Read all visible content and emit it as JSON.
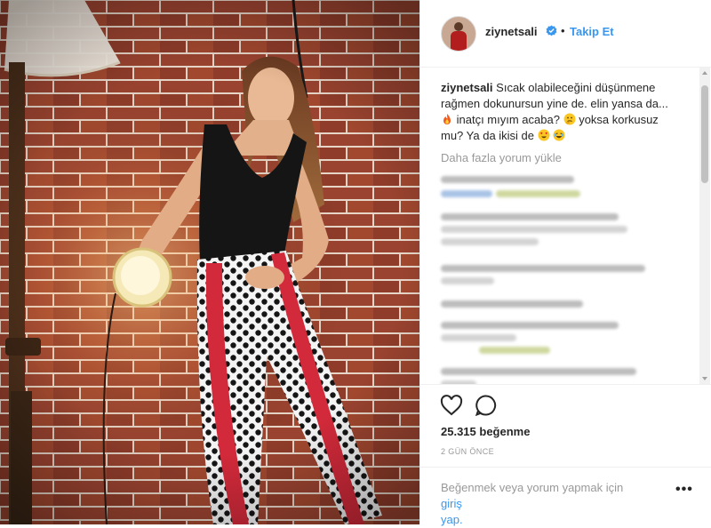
{
  "post": {
    "username": "ziynetsali",
    "verified_icon": "verified-badge-icon",
    "separator": "•",
    "follow_label": "Takip Et",
    "caption": {
      "username": "ziynetsali",
      "text_part1": "Sıcak olabileceğini düşünmene rağmen dokunursun yine de. elin yansa da...",
      "emoji1": "fire-emoji",
      "text_part2": "inatçı mıyım acaba?",
      "emoji2": "thinking-emoji",
      "text_part3": "yoksa korkusuz mu? Ya da ikisi de",
      "emoji3": "heart-eyes-emoji",
      "emoji4": "laughing-emoji"
    },
    "load_more_label": "Daha fazla yorum yükle",
    "likes_label": "25.315 beğenme",
    "date_label": "2 GÜN ÖNCE",
    "login_prompt": "Beğenmek veya yorum yapmak için",
    "login_link": "giriş",
    "login_suffix": "yap.",
    "more_options": "•••"
  },
  "icons": {
    "like": "heart-icon",
    "comment": "comment-bubble-icon"
  },
  "colors": {
    "link_blue": "#3897f0",
    "text": "#262626",
    "muted": "#999999",
    "brick": "#8a3b28"
  }
}
